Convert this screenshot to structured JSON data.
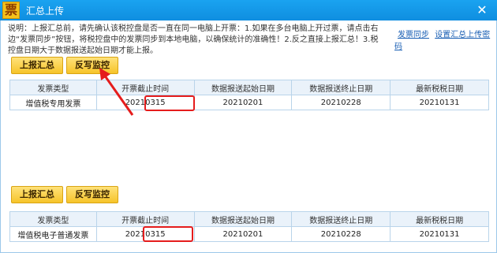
{
  "window": {
    "logo_char": "票",
    "title": "汇总上传",
    "close_glyph": "✕"
  },
  "notice": "说明：上报汇总前，请先确认该税控盘是否一直在同一电脑上开票：1.如果在多台电脑上开过票，请点击右边“发票同步”按钮，将税控盘中的发票同步到本地电脑，以确保统计的准确性！2.反之直接上报汇总！3.税控盘日期大于数据报送起始日期才能上报。",
  "links": {
    "sync": "发票同步",
    "settings": "设置汇总上传密码"
  },
  "section1": {
    "report_button": "上报汇总",
    "writeback_button": "反写监控",
    "headers": [
      "发票类型",
      "开票截止时间",
      "数据报送起始日期",
      "数据报送终止日期",
      "最新税税日期"
    ],
    "row": [
      "增值税专用发票",
      "20210315",
      "20210201",
      "20210228",
      "20210131"
    ]
  },
  "section2": {
    "report_button": "上报汇总",
    "writeback_button": "反写监控",
    "headers": [
      "发票类型",
      "开票截止时间",
      "数据报送起始日期",
      "数据报送终止日期",
      "最新税税日期"
    ],
    "row": [
      "增值税电子普通发票",
      "20210315",
      "20210201",
      "20210228",
      "20210131"
    ]
  },
  "colors": {
    "titlebar": "#1aa3f0",
    "button": "#f6c42a",
    "highlight": "#e51c1c",
    "link": "#1a5fb4"
  }
}
